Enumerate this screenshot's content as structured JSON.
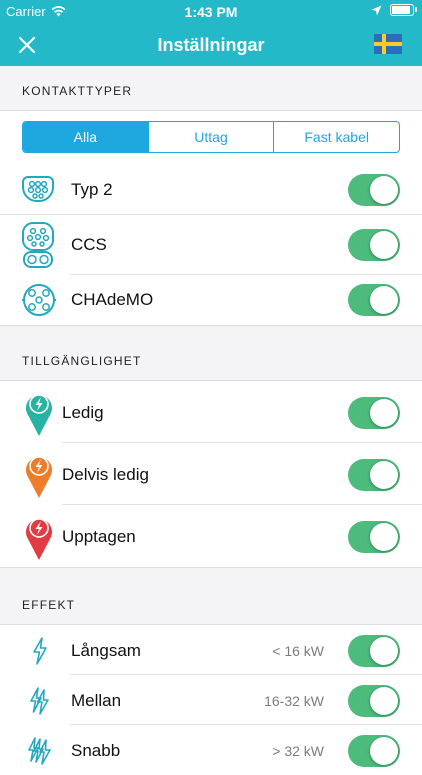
{
  "status_bar": {
    "carrier": "Carrier",
    "time": "1:43 PM",
    "battery_level": 1.0
  },
  "nav": {
    "title": "Inställningar",
    "close_icon": "close-icon",
    "flag_icon": "sweden-flag-icon"
  },
  "connector_types": {
    "header": "KONTAKTTYPER",
    "filter": {
      "options": [
        "Alla",
        "Uttag",
        "Fast kabel"
      ],
      "selected": "Alla"
    },
    "items": [
      {
        "label": "Typ 2",
        "icon": "type2-connector-icon",
        "enabled": true
      },
      {
        "label": "CCS",
        "icon": "ccs-connector-icon",
        "enabled": true
      },
      {
        "label": "CHAdeMO",
        "icon": "chademo-connector-icon",
        "enabled": true
      }
    ]
  },
  "availability": {
    "header": "TILLGÄNGLIGHET",
    "items": [
      {
        "label": "Ledig",
        "color": "#27b2a3",
        "icon": "map-pin-available-icon",
        "enabled": true
      },
      {
        "label": "Delvis ledig",
        "color": "#ee7d2a",
        "icon": "map-pin-partly-available-icon",
        "enabled": true
      },
      {
        "label": "Upptagen",
        "color": "#e23b43",
        "icon": "map-pin-occupied-icon",
        "enabled": true
      }
    ]
  },
  "power": {
    "header": "EFFEKT",
    "items": [
      {
        "label": "Långsam",
        "range": "< 16 kW",
        "icon": "lightning-slow-icon",
        "enabled": true
      },
      {
        "label": "Mellan",
        "range": "16-32 kW",
        "icon": "lightning-medium-icon",
        "enabled": true
      },
      {
        "label": "Snabb",
        "range": "> 32 kW",
        "icon": "lightning-fast-icon",
        "enabled": true
      }
    ]
  },
  "colors": {
    "accent": "#23b9c9",
    "segment": "#1fa8e0",
    "toggle_on": "#4cbb7c"
  }
}
